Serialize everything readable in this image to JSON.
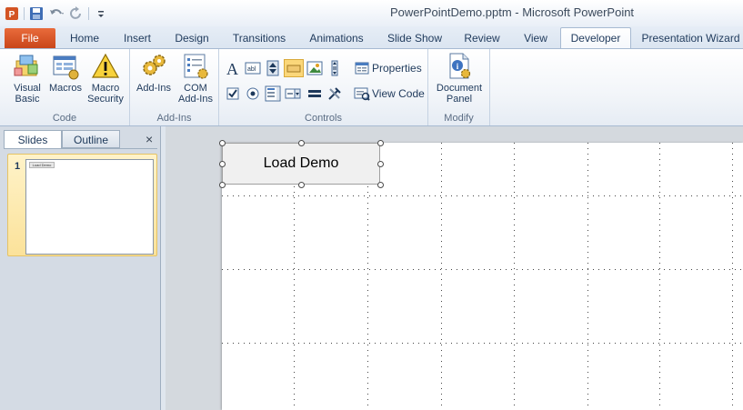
{
  "window": {
    "title": "PowerPointDemo.pptm  -  Microsoft PowerPoint"
  },
  "qat": {
    "app_icon": "powerpoint-app-icon",
    "items": [
      "save-icon",
      "undo-icon",
      "redo-icon",
      "customize-qat-icon"
    ]
  },
  "tabs": [
    {
      "label": "File"
    },
    {
      "label": "Home"
    },
    {
      "label": "Insert"
    },
    {
      "label": "Design"
    },
    {
      "label": "Transitions"
    },
    {
      "label": "Animations"
    },
    {
      "label": "Slide Show"
    },
    {
      "label": "Review"
    },
    {
      "label": "View"
    },
    {
      "label": "Developer"
    },
    {
      "label": "Presentation Wizard"
    }
  ],
  "active_tab": "Developer",
  "ribbon": {
    "code": {
      "label": "Code",
      "visual_basic": "Visual\nBasic",
      "macros": "Macros",
      "macro_security": "Macro\nSecurity"
    },
    "addins": {
      "label": "Add-Ins",
      "addins_button": "Add-Ins",
      "com_addins": "COM\nAdd-Ins"
    },
    "controls": {
      "label": "Controls",
      "properties": "Properties",
      "view_code": "View Code"
    },
    "modify": {
      "label": "Modify",
      "document_panel": "Document\nPanel"
    }
  },
  "left_pane": {
    "tab_slides": "Slides",
    "tab_outline": "Outline",
    "close": "×",
    "slide_number": "1"
  },
  "slide": {
    "button_label": "Load Demo"
  },
  "colors": {
    "file_tab": "#d35424",
    "accent": "#1e395b",
    "selection": "#fbe29a"
  }
}
